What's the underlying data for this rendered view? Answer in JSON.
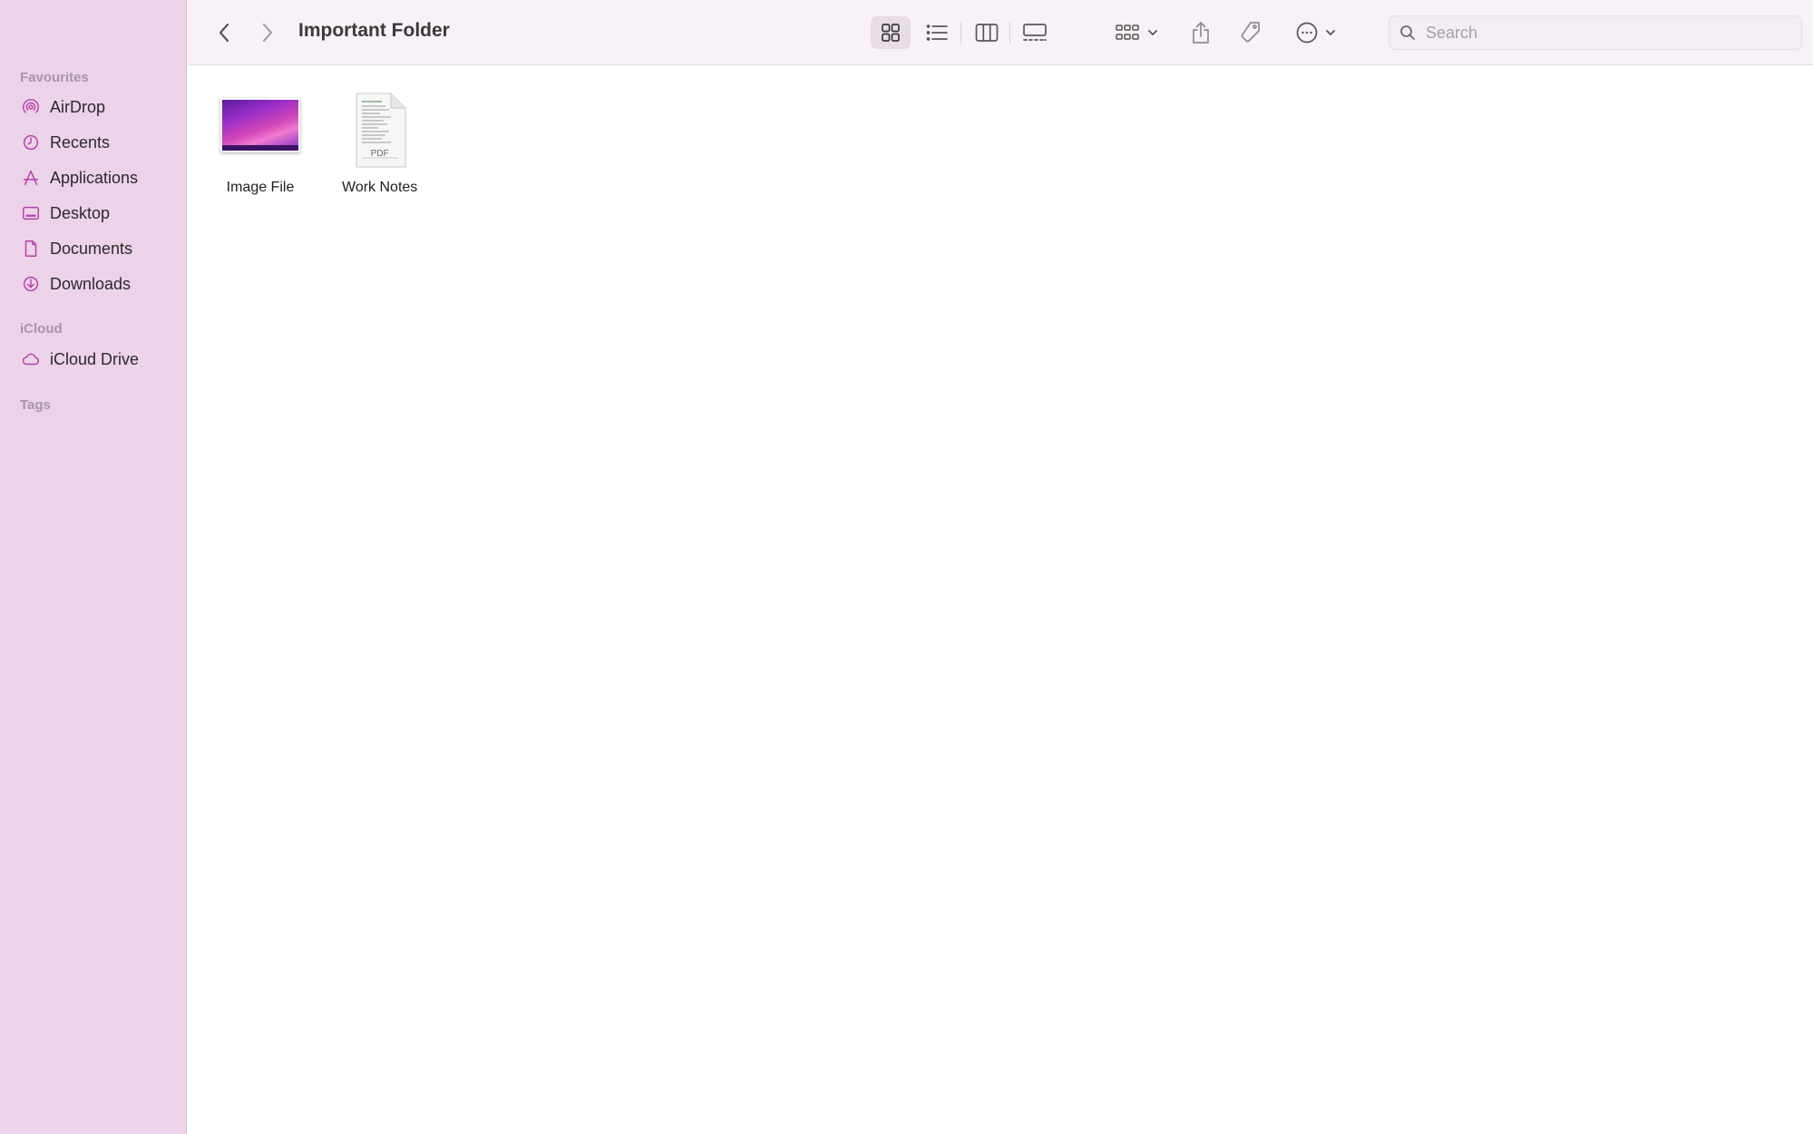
{
  "window": {
    "title": "Important Folder"
  },
  "sidebar": {
    "sections": [
      {
        "label": "Favourites"
      },
      {
        "label": "iCloud"
      },
      {
        "label": "Tags"
      }
    ],
    "favourites": [
      {
        "label": "AirDrop",
        "icon": "airdrop-icon"
      },
      {
        "label": "Recents",
        "icon": "clock-icon"
      },
      {
        "label": "Applications",
        "icon": "applications-icon"
      },
      {
        "label": "Desktop",
        "icon": "desktop-icon"
      },
      {
        "label": "Documents",
        "icon": "document-icon"
      },
      {
        "label": "Downloads",
        "icon": "download-icon"
      }
    ],
    "icloud": [
      {
        "label": "iCloud Drive",
        "icon": "cloud-icon"
      }
    ],
    "icon_color": "#b93fb0"
  },
  "toolbar": {
    "back_icon": "chevron-left-icon",
    "forward_icon": "chevron-right-icon",
    "view_modes": [
      "icon-view",
      "list-view",
      "column-view",
      "gallery-view"
    ],
    "active_view": "icon-view"
  },
  "search": {
    "placeholder": "Search",
    "value": ""
  },
  "files": [
    {
      "name": "Image File",
      "kind": "image"
    },
    {
      "name": "Work Notes",
      "kind": "pdf",
      "badge": "PDF"
    }
  ]
}
